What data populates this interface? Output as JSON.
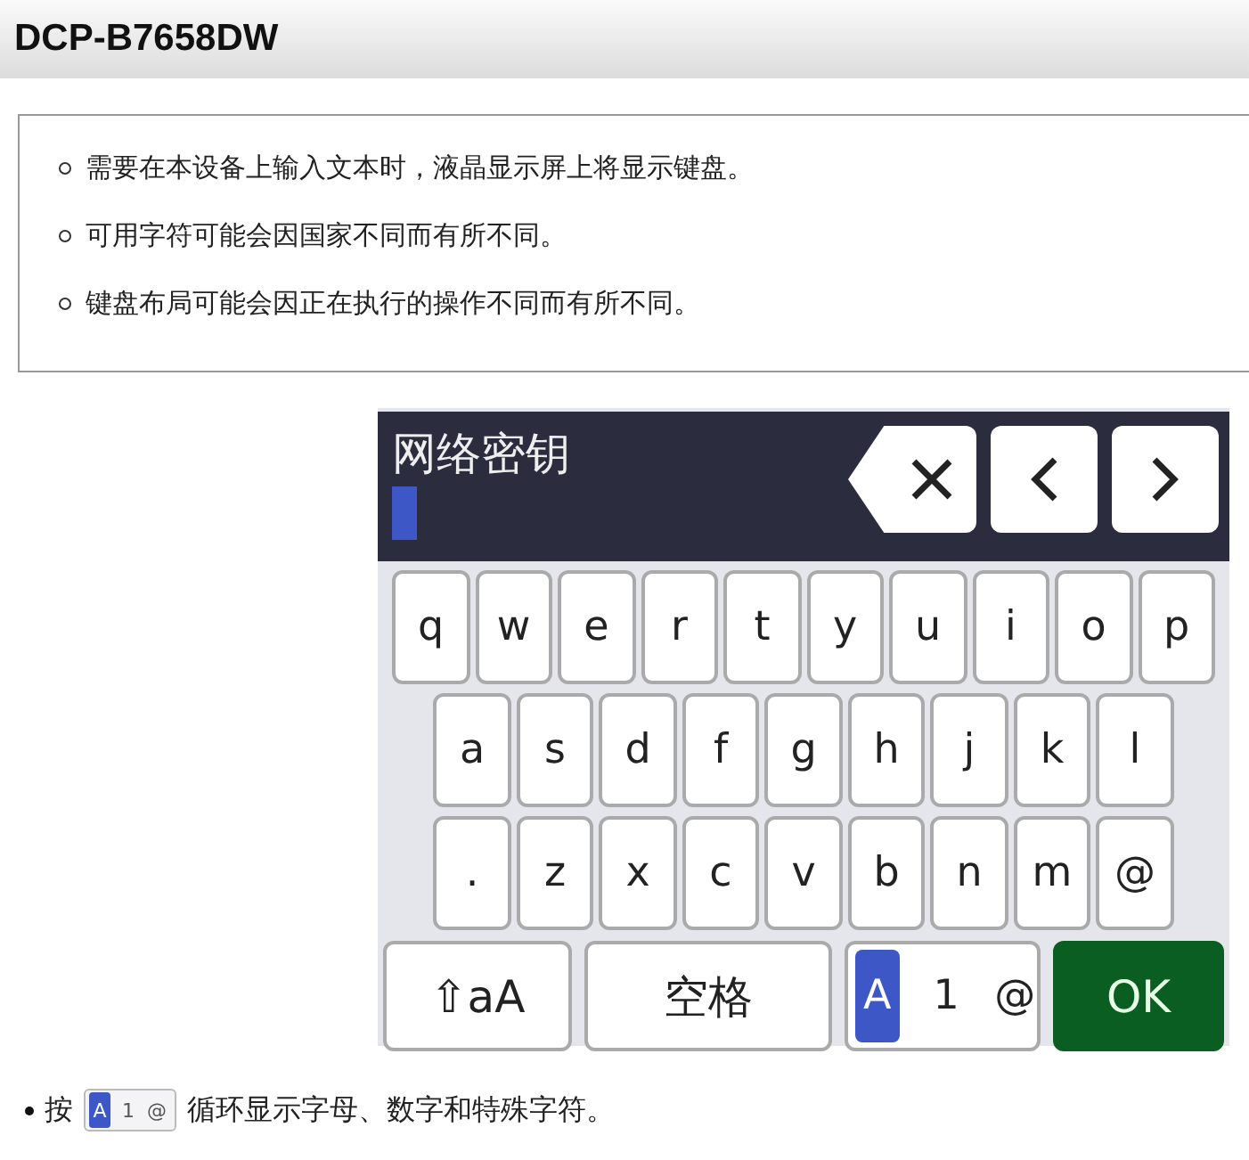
{
  "header": {
    "title": "DCP-B7658DW"
  },
  "notes": [
    "需要在本设备上输入文本时，液晶显示屏上将显示键盘。",
    "可用字符可能会因国家不同而有所不同。",
    "键盘布局可能会因正在执行的操作不同而有所不同。"
  ],
  "keyboard": {
    "field_label": "网络密钥",
    "key_rows": [
      [
        "q",
        "w",
        "e",
        "r",
        "t",
        "y",
        "u",
        "i",
        "o",
        "p"
      ],
      [
        "a",
        "s",
        "d",
        "f",
        "g",
        "h",
        "j",
        "k",
        "l"
      ],
      [
        ".",
        "z",
        "x",
        "c",
        "v",
        "b",
        "n",
        "m",
        "@"
      ]
    ],
    "bottom_keys": [
      {
        "kind": "shift",
        "label": "⇧aA"
      },
      {
        "kind": "space",
        "label": "空格"
      },
      {
        "kind": "mode",
        "modes": [
          {
            "label": "A",
            "selected": true
          },
          {
            "label": "1",
            "selected": false
          },
          {
            "label": "@",
            "selected": false
          }
        ]
      },
      {
        "kind": "ok",
        "label": "OK"
      }
    ]
  },
  "instruction": {
    "prefix": "按",
    "modes": [
      {
        "label": "A",
        "selected": true
      },
      {
        "label": "1",
        "selected": false
      },
      {
        "label": "@",
        "selected": false
      }
    ],
    "suffix": "循环显示字母、数字和特殊字符。"
  }
}
